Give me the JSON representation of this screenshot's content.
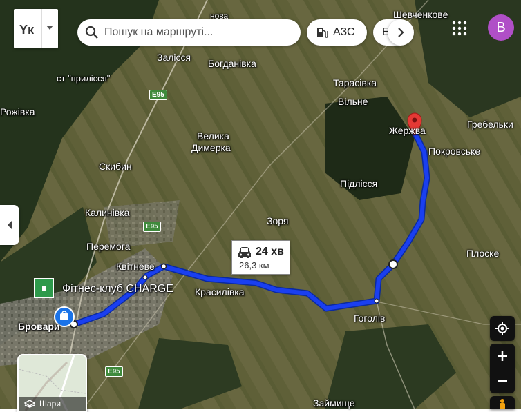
{
  "top_bar": {
    "language_label": "Yк",
    "search_placeholder": "Пошук на маршруті...",
    "chip_gas_label": "АЗС",
    "chip_partial_label": "Е",
    "avatar_letter": "B"
  },
  "route": {
    "duration": "24 хв",
    "distance": "26,3 км",
    "color": "#1a3ff0"
  },
  "places": {
    "brovary": "Бровари",
    "fitness": "Фітнес-клуб CHARGE",
    "kvitneve": "Квітневе",
    "krasylivka": "Красилівка",
    "hoholiv": "Гоголів",
    "zhernivka": "Жержва",
    "pokrovske": "Покровське",
    "pidlissia": "Підлісся",
    "zoria": "Зоря",
    "plosko": "Плоске",
    "peremoha": "Перемога",
    "kalynivka": "Калинівка",
    "skybyn": "Скибин",
    "velyka_dymerka_1": "Велика",
    "velyka_dymerka_2": "Димерка",
    "zalissia": "Залісся",
    "bohdanivka": "Богданівка",
    "prylissia": "ст \"прилісся\"",
    "rozhivka": "Рожівка",
    "tarasivka": "Тарасівка",
    "vilne": "Вільне",
    "hrebelky": "Гребельки",
    "shevchenkove": "Шевченкове",
    "nova": "нова",
    "zaimyshche": "Займище"
  },
  "road_shields": [
    "E95",
    "E95",
    "E95"
  ],
  "minimap_label": "Шари",
  "icons": [
    "search-icon",
    "gas-station-icon",
    "chevron-right-icon",
    "apps-grid-icon",
    "locate-icon",
    "zoom-in-icon",
    "zoom-out-icon",
    "pegman-icon",
    "car-icon",
    "destination-pin-icon",
    "collapse-left-icon"
  ]
}
